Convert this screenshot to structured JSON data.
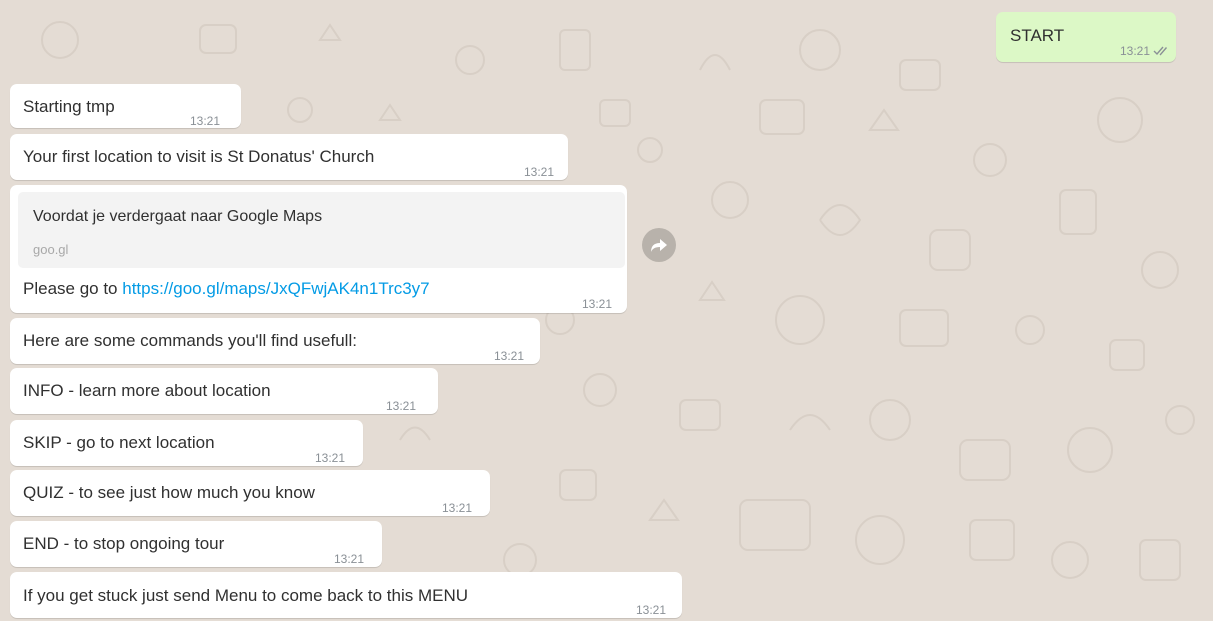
{
  "conversation": {
    "outgoing": {
      "text": "START",
      "time": "13:21",
      "status_icon": "double-check-icon"
    },
    "incoming": [
      {
        "text": "Starting tmp",
        "time": "13:21"
      },
      {
        "text": "Your first location to visit is  St Donatus' Church",
        "time": "13:21"
      },
      {
        "preview_title": "Voordat je verdergaat naar Google Maps",
        "preview_domain": "goo.gl",
        "text_prefix": "Please go to ",
        "link": "https://goo.gl/maps/JxQFwjAK4n1Trc3y7",
        "time": "13:21"
      },
      {
        "text": "Here are some commands you'll find usefull:",
        "time": "13:21"
      },
      {
        "text": "INFO - learn more about location",
        "time": "13:21"
      },
      {
        "text": "SKIP - go to next location",
        "time": "13:21"
      },
      {
        "text": "QUIZ - to see just how much you know",
        "time": "13:21"
      },
      {
        "text": "END - to stop ongoing tour",
        "time": "13:21"
      },
      {
        "text": "If you get stuck just send Menu to come back to this MENU",
        "time": "13:21"
      }
    ]
  },
  "colors": {
    "background": "#e4dcd4",
    "incoming_bubble": "#ffffff",
    "outgoing_bubble": "#dcf8c6",
    "link": "#039be5",
    "timestamp": "#8a9096"
  }
}
